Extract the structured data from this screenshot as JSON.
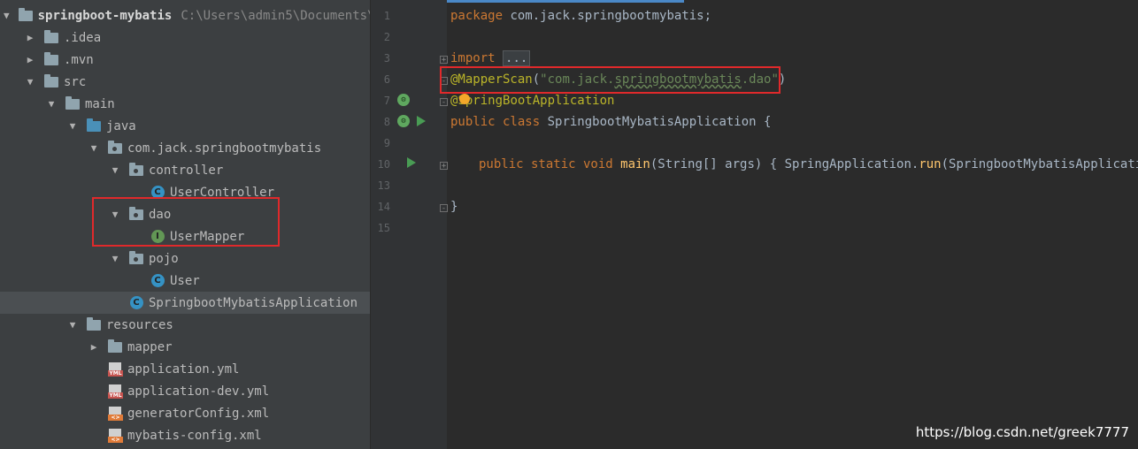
{
  "project": {
    "name": "springboot-mybatis",
    "path": "C:\\Users\\admin5\\Documents\\"
  },
  "tree": [
    {
      "label": ".idea",
      "icon": "folder-icon",
      "depth": 1,
      "arrow": "▶"
    },
    {
      "label": ".mvn",
      "icon": "folder-icon",
      "depth": 1,
      "arrow": "▶"
    },
    {
      "label": "src",
      "icon": "folder-icon",
      "depth": 1,
      "arrow": "▼"
    },
    {
      "label": "main",
      "icon": "folder-icon",
      "depth": 2,
      "arrow": "▼"
    },
    {
      "label": "java",
      "icon": "source-folder-icon",
      "depth": 3,
      "arrow": "▼"
    },
    {
      "label": "com.jack.springbootmybatis",
      "icon": "package-icon",
      "depth": 4,
      "arrow": "▼"
    },
    {
      "label": "controller",
      "icon": "package-icon",
      "depth": 5,
      "arrow": "▼"
    },
    {
      "label": "UserController",
      "icon": "class-icon",
      "depth": 6,
      "arrow": ""
    },
    {
      "label": "dao",
      "icon": "package-icon",
      "depth": 5,
      "arrow": "▼"
    },
    {
      "label": "UserMapper",
      "icon": "interface-icon",
      "depth": 6,
      "arrow": ""
    },
    {
      "label": "pojo",
      "icon": "package-icon",
      "depth": 5,
      "arrow": "▼"
    },
    {
      "label": "User",
      "icon": "class-icon",
      "depth": 6,
      "arrow": ""
    },
    {
      "label": "SpringbootMybatisApplication",
      "icon": "spring-boot-class-icon",
      "depth": 5,
      "arrow": "",
      "selected": true
    },
    {
      "label": "resources",
      "icon": "folder-icon",
      "depth": 3,
      "arrow": "▼"
    },
    {
      "label": "mapper",
      "icon": "folder-icon",
      "depth": 4,
      "arrow": "▶"
    },
    {
      "label": "application.yml",
      "icon": "yml-file-icon",
      "depth": 4,
      "arrow": ""
    },
    {
      "label": "application-dev.yml",
      "icon": "yml-file-icon",
      "depth": 4,
      "arrow": ""
    },
    {
      "label": "generatorConfig.xml",
      "icon": "xml-file-icon",
      "depth": 4,
      "arrow": ""
    },
    {
      "label": "mybatis-config.xml",
      "icon": "xml-file-icon",
      "depth": 4,
      "arrow": ""
    }
  ],
  "file_badges": {
    "yml": "YML",
    "xml": "<>"
  },
  "editor": {
    "line_numbers": [
      "1",
      "2",
      "3",
      "6",
      "7",
      "8",
      "9",
      "10",
      "13",
      "14",
      "15"
    ],
    "code": {
      "l1_kw": "package",
      "l1_rest": " com.jack.springbootmybatis;",
      "l3_kw": "import",
      "l3_fold": "...",
      "l6_ann": "@MapperScan",
      "l6_open": "(",
      "l6_str_a": "\"com.jack.",
      "l6_str_b": "springbootmybatis",
      "l6_str_c": ".dao\"",
      "l6_close": ")",
      "l7_ann_a": "@",
      "l7_ann_b": "SpringBootApplication",
      "l8_kw": "public class",
      "l8_cls": " SpringbootMybatisApplication ",
      "l8_brace": "{",
      "l10_kw": "public static void",
      "l10_fn": " main",
      "l10_rest": "(String[] args) ",
      "l10_brace": "{",
      "l10_call_a": " SpringApplication.",
      "l10_call_fn": "run",
      "l10_call_b": "(SpringbootMybatisApplication.c",
      "l14_brace": "}"
    }
  },
  "watermark": "https://blog.csdn.net/greek7777",
  "colors": {
    "highlight_box": "#e0292b",
    "keyword": "#cc7832",
    "annotation": "#bbb529",
    "string": "#6a8759"
  }
}
